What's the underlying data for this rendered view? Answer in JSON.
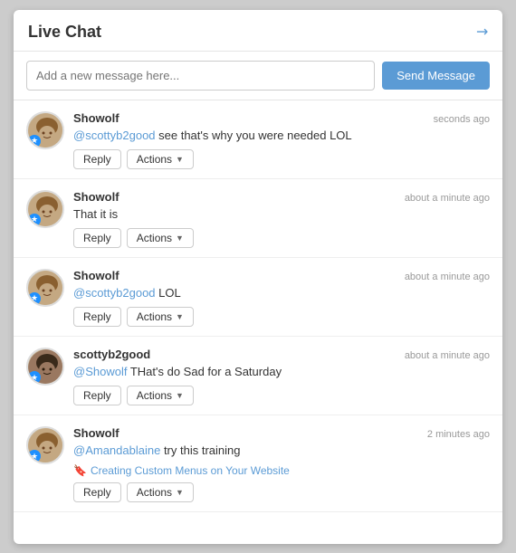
{
  "panel": {
    "title": "Live Chat",
    "input_placeholder": "Add a new message here...",
    "send_button_label": "Send Message"
  },
  "messages": [
    {
      "id": 1,
      "sender": "Showolf",
      "timestamp": "seconds ago",
      "text_parts": [
        {
          "type": "mention",
          "text": "@scottyb2good"
        },
        {
          "type": "text",
          "text": " see that's why you were needed LOL"
        }
      ],
      "avatar_type": "showolf",
      "has_star": true,
      "link": null
    },
    {
      "id": 2,
      "sender": "Showolf",
      "timestamp": "about a minute ago",
      "text_parts": [
        {
          "type": "text",
          "text": "That it is"
        }
      ],
      "avatar_type": "showolf",
      "has_star": true,
      "link": null
    },
    {
      "id": 3,
      "sender": "Showolf",
      "timestamp": "about a minute ago",
      "text_parts": [
        {
          "type": "mention",
          "text": "@scottyb2good"
        },
        {
          "type": "text",
          "text": " LOL"
        }
      ],
      "avatar_type": "showolf",
      "has_star": true,
      "link": null
    },
    {
      "id": 4,
      "sender": "scottyb2good",
      "timestamp": "about a minute ago",
      "text_parts": [
        {
          "type": "mention",
          "text": "@Showolf"
        },
        {
          "type": "text",
          "text": " THat's do Sad for a Saturday"
        }
      ],
      "avatar_type": "scotty",
      "has_star": true,
      "link": null
    },
    {
      "id": 5,
      "sender": "Showolf",
      "timestamp": "2 minutes ago",
      "text_parts": [
        {
          "type": "mention",
          "text": "@Amandablaine"
        },
        {
          "type": "text",
          "text": " try this training"
        }
      ],
      "avatar_type": "showolf",
      "has_star": true,
      "link": {
        "icon": "bookmark",
        "text": "Creating Custom Menus on Your Website"
      }
    }
  ],
  "buttons": {
    "reply": "Reply",
    "actions": "Actions"
  }
}
